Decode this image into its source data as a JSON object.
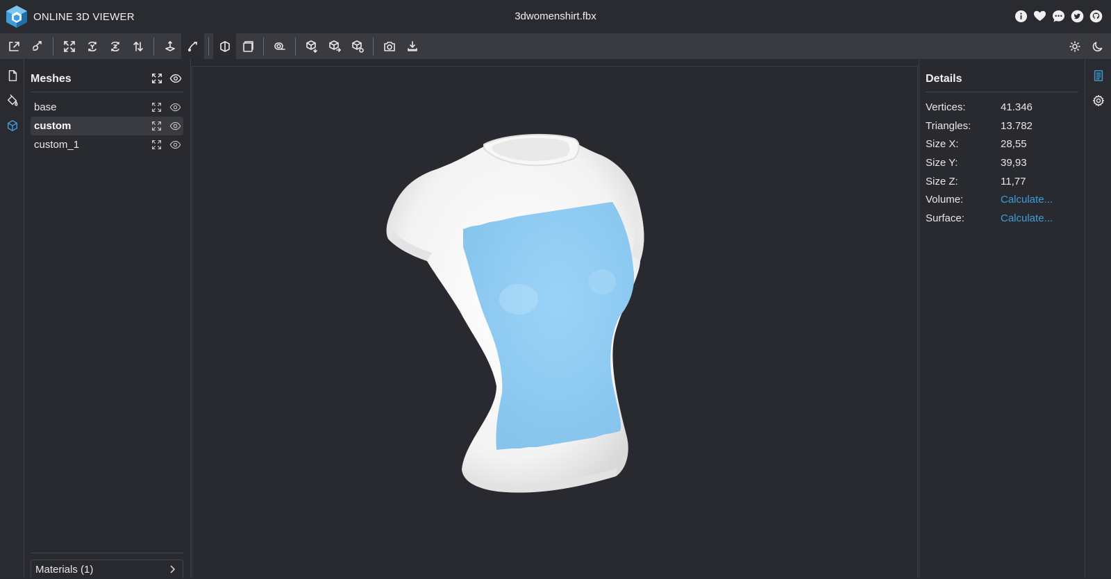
{
  "header": {
    "app_title": "ONLINE 3D VIEWER",
    "file_name": "3dwomenshirt.fbx",
    "links": [
      "info-icon",
      "heart-icon",
      "discourse-icon",
      "twitter-icon",
      "github-icon"
    ]
  },
  "toolbar": {
    "left_buttons": [
      "open-file",
      "open-url",
      "fit-to-window",
      "align-to-face",
      "set-up-vector-y",
      "flip-up-vector",
      "fixed-up-vector",
      "free-orbit",
      "perspective-camera",
      "orthographic-camera",
      "measure",
      "export-model",
      "share-model",
      "embed-model",
      "snapshot",
      "settings-download"
    ],
    "right_buttons": [
      "light-mode-icon",
      "dark-mode-icon"
    ]
  },
  "meshes_panel": {
    "title": "Meshes",
    "items": [
      {
        "label": "base",
        "selected": false
      },
      {
        "label": "custom",
        "selected": true
      },
      {
        "label": "custom_1",
        "selected": false
      }
    ],
    "materials_label": "Materials (1)"
  },
  "details_panel": {
    "title": "Details",
    "rows": [
      {
        "key": "Vertices:",
        "value": "41.346"
      },
      {
        "key": "Triangles:",
        "value": "13.782"
      },
      {
        "key": "Size X:",
        "value": "28,55"
      },
      {
        "key": "Size Y:",
        "value": "39,93"
      },
      {
        "key": "Size Z:",
        "value": "11,77"
      },
      {
        "key": "Volume:",
        "value": "Calculate..."
      },
      {
        "key": "Surface:",
        "value": "Calculate..."
      }
    ]
  },
  "colors": {
    "background": "#292a2f",
    "toolbar": "#3a3b41",
    "accent": "#3d9ddb",
    "mesh_highlight": "#8fcaf2",
    "shirt": "#ffffff"
  }
}
